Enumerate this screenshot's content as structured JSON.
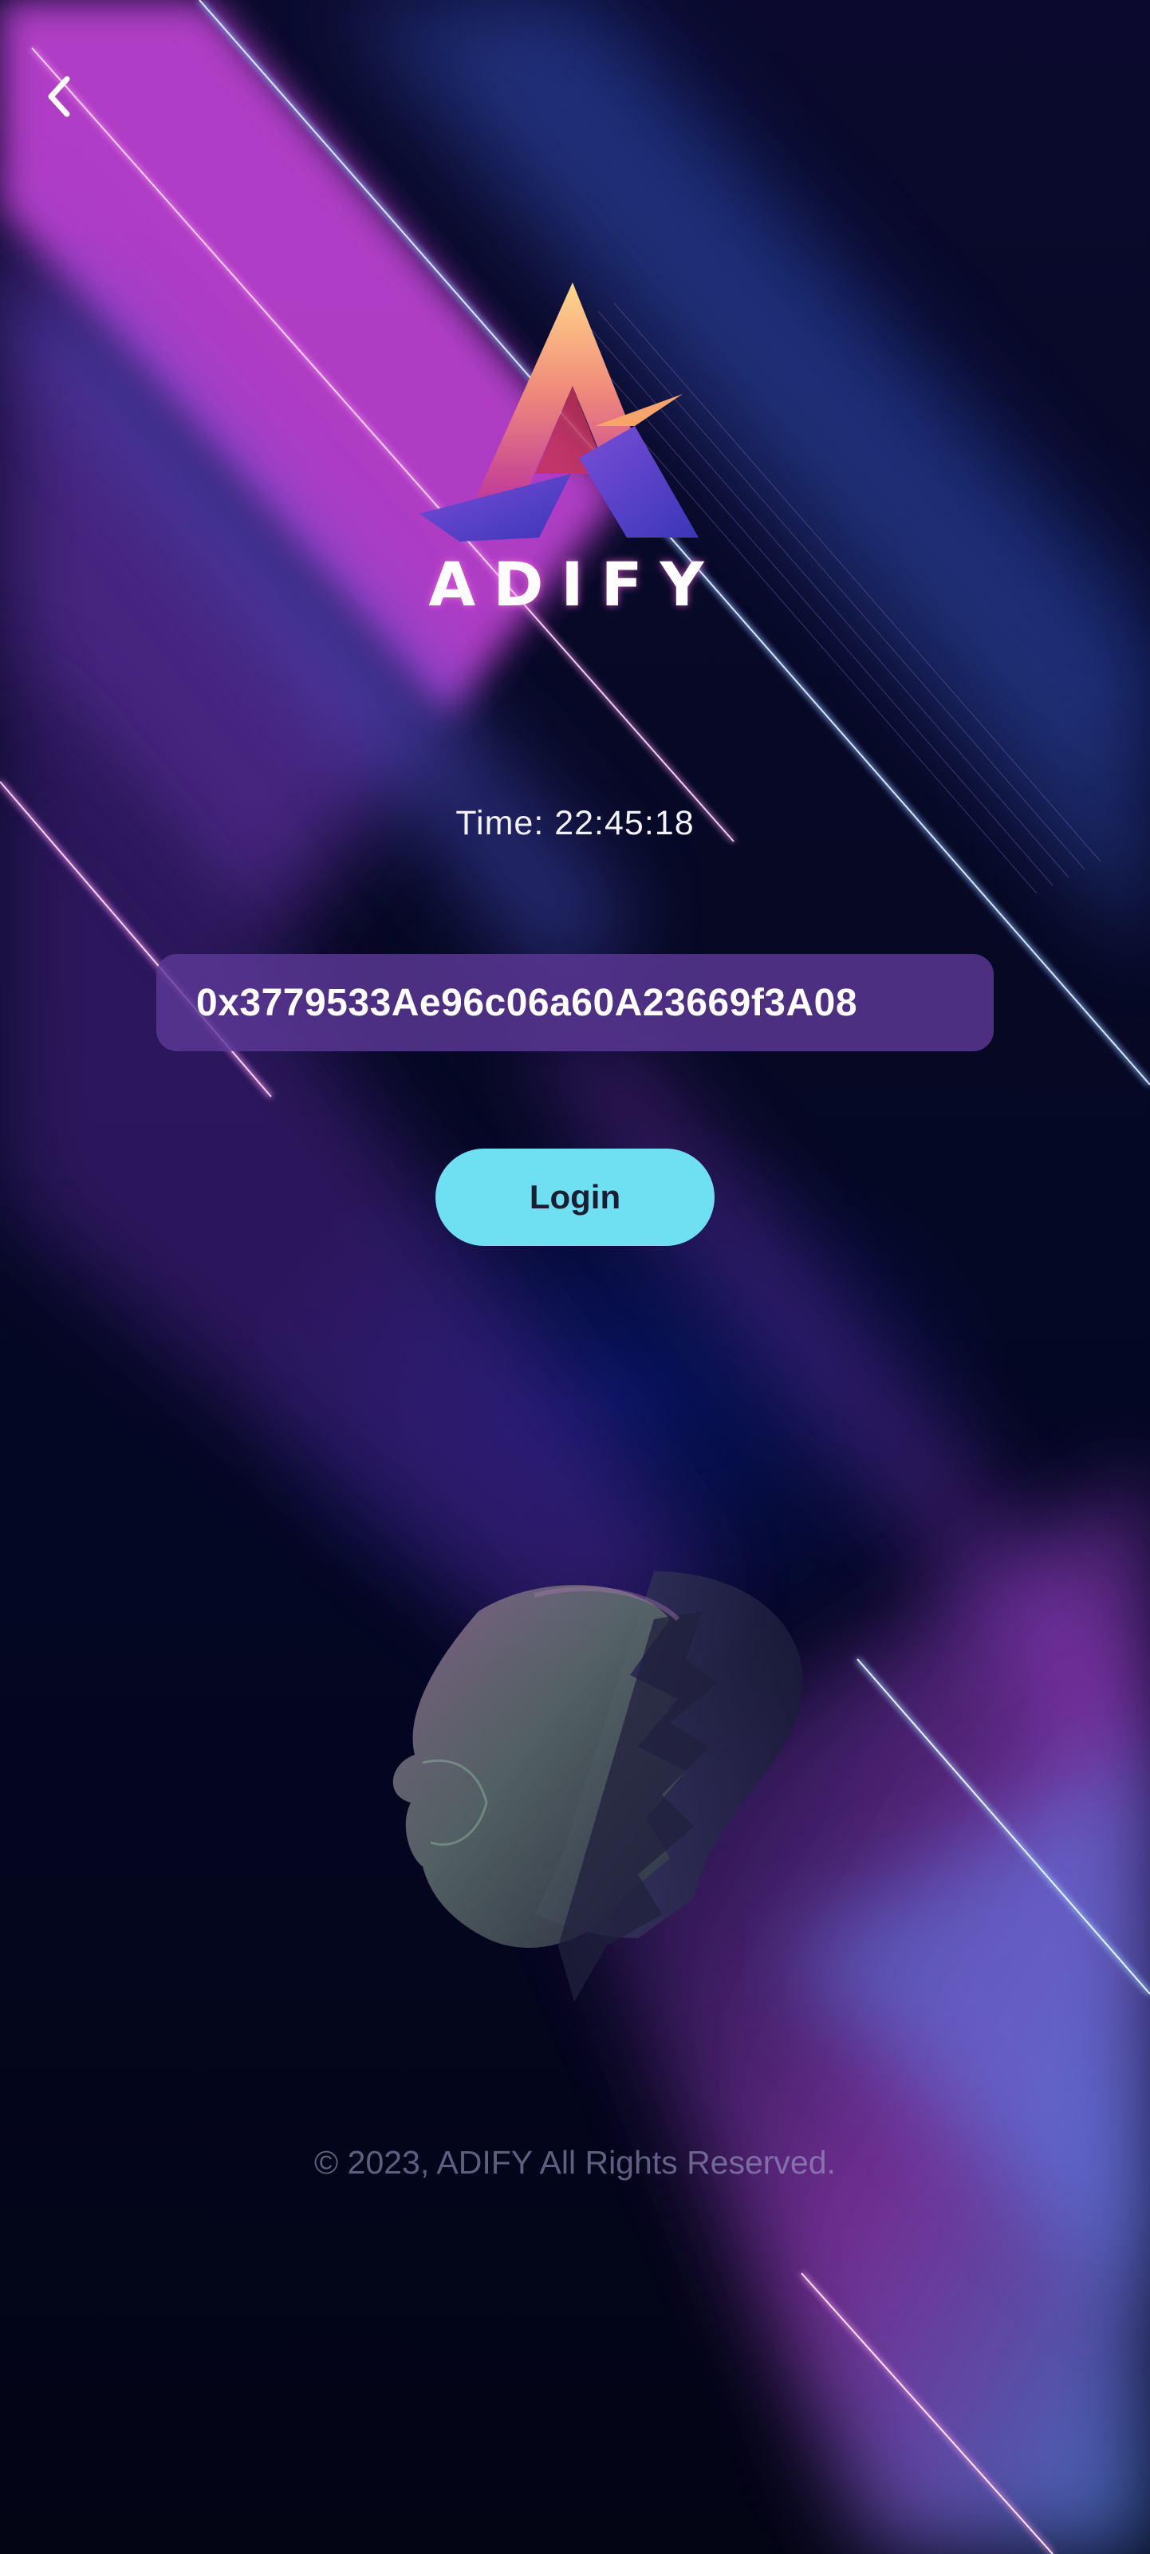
{
  "app": {
    "brand_name": "ADIFY",
    "time_text": "Time: 22:45:18",
    "wallet_address": "0x3779533Ae96c06a60A23669f3A08",
    "login_label": "Login",
    "footer_text": "© 2023, ADIFY All Rights Reserved."
  },
  "icons": {
    "back": "chevron-left-icon",
    "logo": "adify-logo",
    "hero": "ai-head-illustration"
  },
  "colors": {
    "background": "#05061a",
    "address_field": "#5c3896",
    "login_button": "#6ee0f1",
    "accent_magenta": "#d44bd8",
    "accent_blue": "#4c7ff0"
  }
}
